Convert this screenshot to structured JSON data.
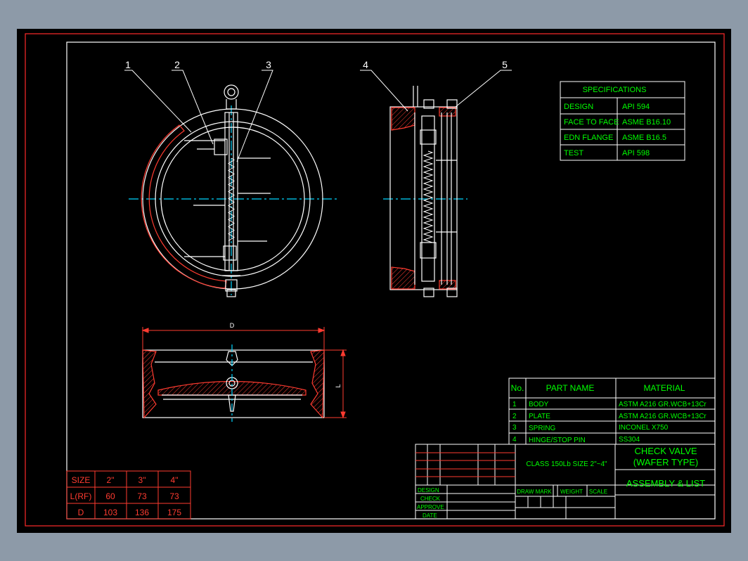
{
  "balloons": [
    "1",
    "2",
    "3",
    "4",
    "5"
  ],
  "dimension_labels": {
    "diameter": "D",
    "length": "L"
  },
  "specifications": {
    "title": "SPECIFICATIONS",
    "rows": [
      {
        "label": "DESIGN",
        "value": "API 594"
      },
      {
        "label": "FACE TO FACE",
        "value": "ASME B16.10"
      },
      {
        "label": "EDN FLANGE",
        "value": "ASME B16.5"
      },
      {
        "label": "TEST",
        "value": "API 598"
      }
    ]
  },
  "parts_list": {
    "headers": {
      "no": "No.",
      "name": "PART NAME",
      "material": "MATERIAL"
    },
    "rows": [
      {
        "no": "1",
        "name": "BODY",
        "material": "ASTM A216 GR.WCB+13Cr"
      },
      {
        "no": "2",
        "name": "PLATE",
        "material": "ASTM A216 GR.WCB+13Cr"
      },
      {
        "no": "3",
        "name": "SPRING",
        "material": "INCONEL X750"
      },
      {
        "no": "4",
        "name": "HINGE/STOP PIN",
        "material": "SS304"
      }
    ]
  },
  "title_block": {
    "title_line1": "CHECK VALVE",
    "title_line2": "(WAFER TYPE)",
    "subtitle": "ASSEMBLY & LIST",
    "class_size": "CLASS 150Lb SIZE 2\"~4\"",
    "signoff": [
      "DESIGN",
      "CHECK",
      "APPROVE",
      "DATE"
    ],
    "info_headers": [
      "DRAW MARK",
      "WEIGHT",
      "SCALE"
    ]
  },
  "size_table": {
    "rows": [
      [
        "SIZE",
        "2\"",
        "3\"",
        "4\""
      ],
      [
        "L(RF)",
        "60",
        "73",
        "73"
      ],
      [
        "D",
        "103",
        "136",
        "175"
      ]
    ]
  },
  "colors": {
    "background": "#000000",
    "frame": "#ff2a2a",
    "line": "#ffffff",
    "text": "#00ff00",
    "hatch": "#ff3b30",
    "center": "#00d5ff"
  }
}
